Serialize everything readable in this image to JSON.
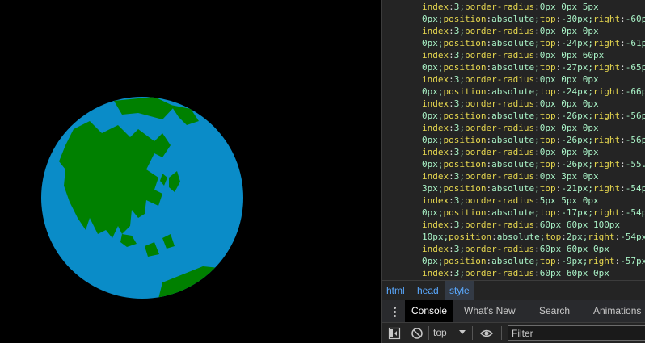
{
  "code_lines": [
    {
      "prop": "index",
      "val": "3;",
      "prop2": "border-radius",
      "val2": "0px 0px 5px"
    },
    {
      "val": "0px;",
      "prop": "position",
      "val2": "absolute;",
      "prop2": "top",
      "val3": "-30px;",
      "prop3": "right",
      "val4": "-60p"
    },
    {
      "prop": "index",
      "val": "3;",
      "prop2": "border-radius",
      "val2": "0px 0px 0px"
    },
    {
      "val": "0px;",
      "prop": "position",
      "val2": "absolute;",
      "prop2": "top",
      "val3": "-24px;",
      "prop3": "right",
      "val4": "-61p"
    },
    {
      "prop": "index",
      "val": "3;",
      "prop2": "border-radius",
      "val2": "0px 0px 60px"
    },
    {
      "val": "0px;",
      "prop": "position",
      "val2": "absolute;",
      "prop2": "top",
      "val3": "-27px;",
      "prop3": "right",
      "val4": "-65p"
    },
    {
      "prop": "index",
      "val": "3;",
      "prop2": "border-radius",
      "val2": "0px 0px 0px"
    },
    {
      "val": "0px;",
      "prop": "position",
      "val2": "absolute;",
      "prop2": "top",
      "val3": "-24px;",
      "prop3": "right",
      "val4": "-66p"
    },
    {
      "prop": "index",
      "val": "3;",
      "prop2": "border-radius",
      "val2": "0px 0px 0px"
    },
    {
      "val": "0px;",
      "prop": "position",
      "val2": "absolute;",
      "prop2": "top",
      "val3": "-26px;",
      "prop3": "right",
      "val4": "-56p"
    },
    {
      "prop": "index",
      "val": "3;",
      "prop2": "border-radius",
      "val2": "0px 0px 0px"
    },
    {
      "val": "0px;",
      "prop": "position",
      "val2": "absolute;",
      "prop2": "top",
      "val3": "-26px;",
      "prop3": "right",
      "val4": "-56p"
    },
    {
      "prop": "index",
      "val": "3;",
      "prop2": "border-radius",
      "val2": "0px 0px 0px"
    },
    {
      "val": "0px;",
      "prop": "position",
      "val2": "absolute;",
      "prop2": "top",
      "val3": "-26px;",
      "prop3": "right",
      "val4": "-55."
    },
    {
      "prop": "index",
      "val": "3;",
      "prop2": "border-radius",
      "val2": "0px 3px 0px"
    },
    {
      "val": "3px;",
      "prop": "position",
      "val2": "absolute;",
      "prop2": "top",
      "val3": "-21px;",
      "prop3": "right",
      "val4": "-54p"
    },
    {
      "prop": "index",
      "val": "3;",
      "prop2": "border-radius",
      "val2": "5px 5px 0px"
    },
    {
      "val": "0px;",
      "prop": "position",
      "val2": "absolute;",
      "prop2": "top",
      "val3": "-17px;",
      "prop3": "right",
      "val4": "-54p"
    },
    {
      "prop": "index",
      "val": "3;",
      "prop2": "border-radius",
      "val2": "60px 60px 100px"
    },
    {
      "val": "10px;",
      "prop": "position",
      "val2": "absolute;",
      "prop2": "top",
      "val3": "2px;",
      "prop3": "right",
      "val4": "-54px"
    },
    {
      "prop": "index",
      "val": "3;",
      "prop2": "border-radius",
      "val2": "60px 60px 0px"
    },
    {
      "val": "0px;",
      "prop": "position",
      "val2": "absolute;",
      "prop2": "top",
      "val3": "-9px;",
      "prop3": "right",
      "val4": "-57px"
    },
    {
      "prop": "index",
      "val": "3;",
      "prop2": "border-radius",
      "val2": "60px 60px 0px"
    }
  ],
  "breadcrumb": [
    "html",
    "head",
    "style"
  ],
  "drawer_tabs": [
    "Console",
    "What's New",
    "Search",
    "Animations"
  ],
  "toolbar": {
    "context": "top",
    "filter_placeholder": "Filter"
  },
  "colors": {
    "ocean": "#0a8cc8",
    "land": "#008000",
    "code_property": "#e6d74f",
    "code_value": "#a9f2c6",
    "link": "#5aa9ff"
  }
}
